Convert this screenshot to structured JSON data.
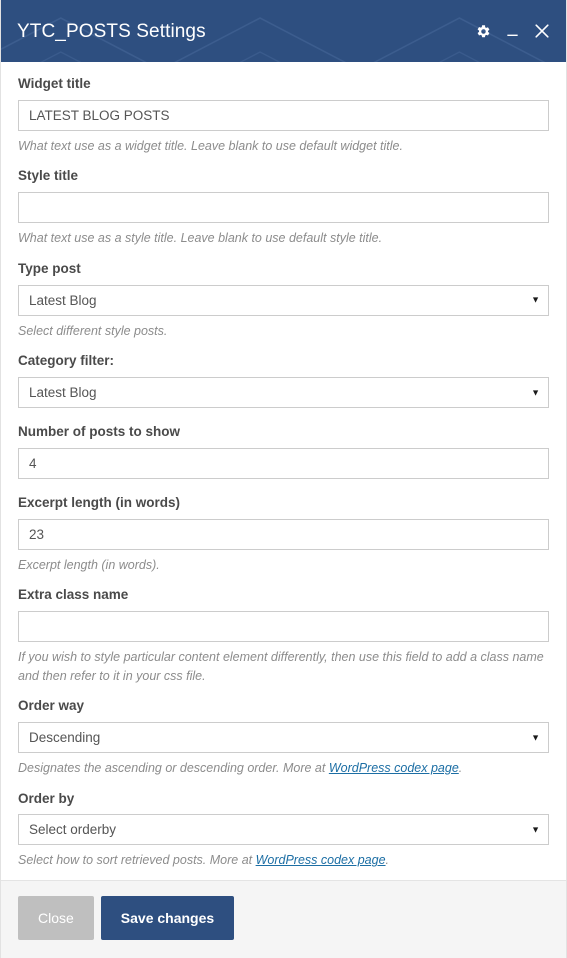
{
  "header": {
    "title": "YTC_POSTS Settings",
    "icons": [
      {
        "name": "gear-icon",
        "label": "Settings"
      },
      {
        "name": "minimize-icon",
        "label": "Minimize"
      },
      {
        "name": "close-icon",
        "label": "Close"
      }
    ],
    "background_color": "#2e4f80"
  },
  "fields": {
    "widget_title": {
      "label": "Widget title",
      "value": "LATEST BLOG POSTS",
      "placeholder": "",
      "help": "What text use as a widget title. Leave blank to use default widget title."
    },
    "style_title": {
      "label": "Style title",
      "value": "",
      "placeholder": "",
      "help": "What text use as a style title. Leave blank to use default style title."
    },
    "type_post": {
      "label": "Type post",
      "value": "Latest Blog",
      "options": [
        "Latest Blog"
      ],
      "help": "Select different style posts."
    },
    "category_filter": {
      "label": "Category filter:",
      "value": "Latest Blog",
      "options": [
        "Latest Blog"
      ],
      "help": ""
    },
    "number_of_posts": {
      "label": "Number of posts to show",
      "value": "4",
      "placeholder": "",
      "help": ""
    },
    "excerpt_length": {
      "label": "Excerpt length (in words)",
      "value": "23",
      "placeholder": "",
      "help": "Excerpt length (in words)."
    },
    "extra_class_name": {
      "label": "Extra class name",
      "value": "",
      "placeholder": "",
      "help": "If you wish to style particular content element differently, then use this field to add a class name and then refer to it in your css file."
    },
    "order_way": {
      "label": "Order way",
      "value": "Descending",
      "options": [
        "Descending"
      ],
      "help_before": "Designates the ascending or descending order. More at ",
      "help_link": "WordPress codex page",
      "help_after": "."
    },
    "order_by": {
      "label": "Order by",
      "value": "Select orderby",
      "options": [
        "Select orderby"
      ],
      "help_before": "Select how to sort retrieved posts. More at ",
      "help_link": "WordPress codex page",
      "help_after": "."
    }
  },
  "footer": {
    "close_label": "Close",
    "save_label": "Save changes",
    "close_color": "#bfbfbf",
    "save_color": "#2e4f80"
  }
}
